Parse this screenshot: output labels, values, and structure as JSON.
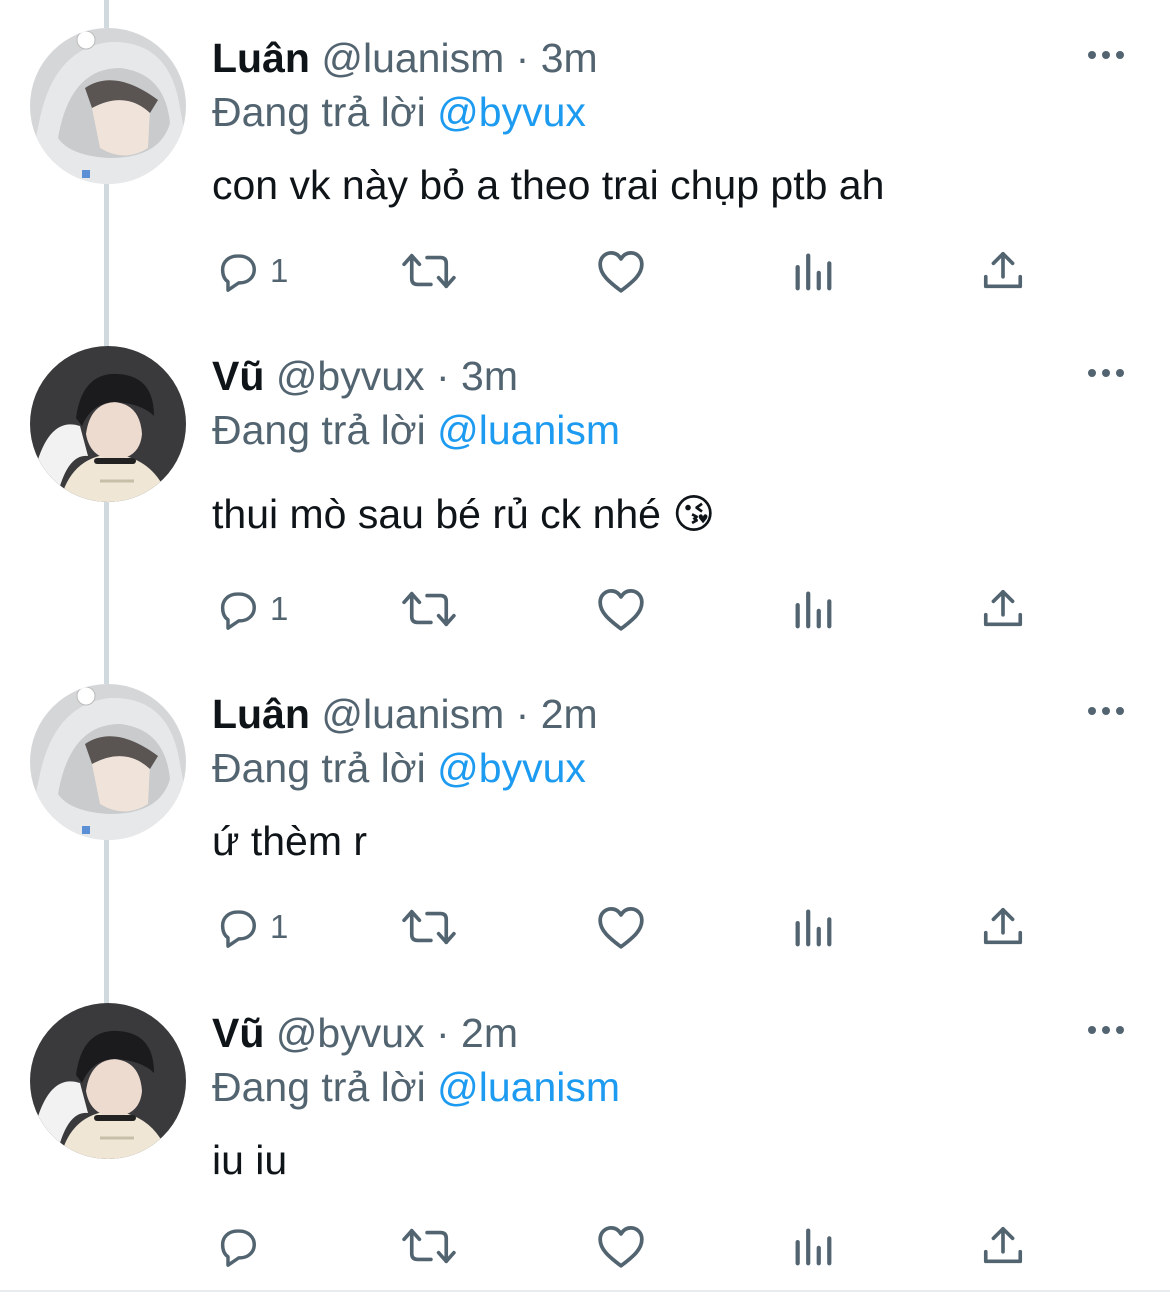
{
  "colors": {
    "primary_text": "#0f1419",
    "secondary_text": "#536471",
    "accent": "#1d9bf0",
    "thread_line": "#cfd9de"
  },
  "tweets": [
    {
      "name": "Luân",
      "handle": "@luanism",
      "separator": "·",
      "time": "3m",
      "replying_prefix": "Đang trả lời",
      "replying_to": "@byvux",
      "text": "con vk này bỏ a theo trai chụp ptb ah",
      "reply_count": "1"
    },
    {
      "name": "Vũ",
      "handle": "@byvux",
      "separator": "·",
      "time": "3m",
      "replying_prefix": "Đang trả lời",
      "replying_to": "@luanism",
      "text": "thui mò sau bé rủ ck nhé",
      "emoji": "😘",
      "reply_count": "1"
    },
    {
      "name": "Luân",
      "handle": "@luanism",
      "separator": "·",
      "time": "2m",
      "replying_prefix": "Đang trả lời",
      "replying_to": "@byvux",
      "text": "ứ thèm r",
      "reply_count": "1"
    },
    {
      "name": "Vũ",
      "handle": "@byvux",
      "separator": "·",
      "time": "2m",
      "replying_prefix": "Đang trả lời",
      "replying_to": "@luanism",
      "text": "iu iu",
      "reply_count": ""
    }
  ]
}
